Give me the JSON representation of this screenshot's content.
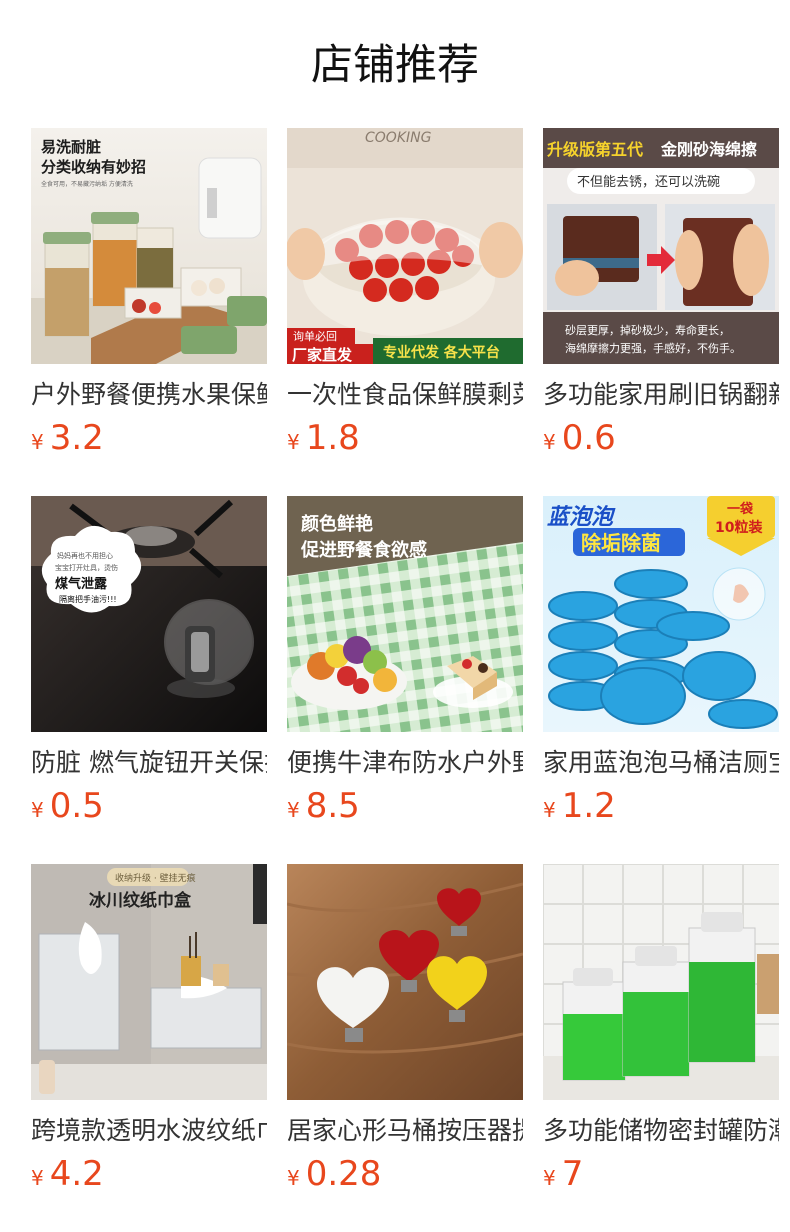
{
  "header": {
    "title": "店铺推荐"
  },
  "currency": "¥",
  "products": [
    {
      "title": "户外野餐便携水果保鲜盒",
      "price": "3.2",
      "image": {
        "icon": "storage-container-image",
        "line1": "易洗耐脏",
        "line2": "分类收纳有妙招",
        "note": "全食可用，不易藏污纳垢 方便清洗"
      }
    },
    {
      "title": "一次性食品保鲜膜剩菜套",
      "price": "1.8",
      "image": {
        "icon": "plastic-wrap-image",
        "top_text": "COOKING",
        "tag": "询单必回",
        "left_banner": "厂家直发",
        "right_banner": "专业代发 各大平台"
      }
    },
    {
      "title": "多功能家用刷旧锅翻新擦",
      "price": "0.6",
      "image": {
        "icon": "sponge-image",
        "headline_a": "升级版第五代",
        "headline_b": "金刚砂海绵擦",
        "pill": "不但能去锈，还可以洗碗",
        "desc1": "砂层更厚，掉砂极少，寿命更长，",
        "desc2": "海绵摩擦力更强，手感好，不伤手。"
      }
    },
    {
      "title": "防脏 燃气旋钮开关保护罩",
      "price": "0.5",
      "image": {
        "icon": "knob-cover-image",
        "bubble1": "妈妈再也不用担心",
        "bubble2": "宝宝打开灶具，烫伤",
        "bubble3": "煤气泄露",
        "bubble4": "隔离把手油污!!!"
      }
    },
    {
      "title": "便携牛津布防水户外野餐垫",
      "price": "8.5",
      "image": {
        "icon": "picnic-mat-image",
        "line1": "颜色鲜艳",
        "line2": "促进野餐食欲感"
      }
    },
    {
      "title": "家用蓝泡泡马桶洁厕宝",
      "price": "1.2",
      "image": {
        "icon": "toilet-cleaner-image",
        "title_a": "蓝泡泡",
        "title_b": "除垢除菌",
        "badge1": "一袋",
        "badge2": "10粒装"
      }
    },
    {
      "title": "跨境款透明水波纹纸巾盒",
      "price": "4.2",
      "image": {
        "icon": "tissue-box-image",
        "pill": "收纳升级 · 壁挂无痕",
        "headline": "冰川纹纸巾盒"
      }
    },
    {
      "title": "居家心形马桶按压器提拉",
      "price": "0.28",
      "image": {
        "icon": "heart-button-image"
      }
    },
    {
      "title": "多功能储物密封罐防潮盒",
      "price": "7",
      "image": {
        "icon": "detergent-jar-image"
      }
    }
  ]
}
